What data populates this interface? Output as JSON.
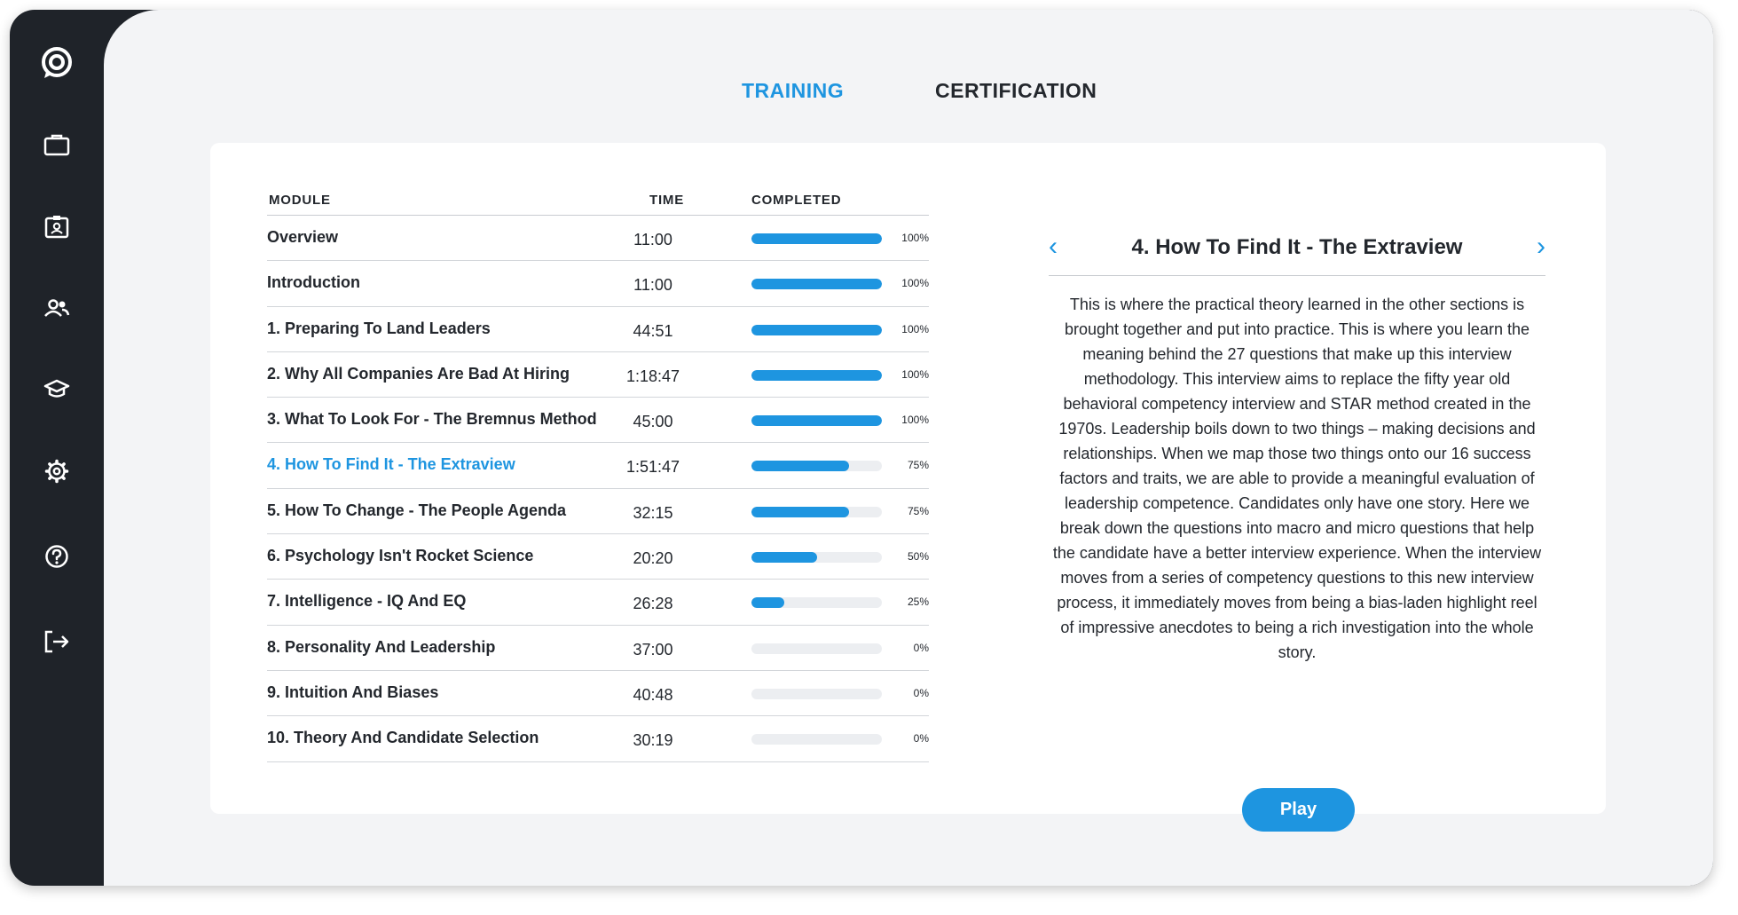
{
  "tabs": [
    {
      "label": "TRAINING"
    },
    {
      "label": "CERTIFICATION"
    }
  ],
  "table": {
    "headers": {
      "module": "MODULE",
      "time": "TIME",
      "completed": "COMPLETED"
    },
    "rows": [
      {
        "module": "Overview",
        "time": "11:00",
        "completed_pct": 100,
        "completed_label": "100%"
      },
      {
        "module": "Introduction",
        "time": "11:00",
        "completed_pct": 100,
        "completed_label": "100%"
      },
      {
        "module": "1.  Preparing To Land Leaders",
        "time": "44:51",
        "completed_pct": 100,
        "completed_label": "100%"
      },
      {
        "module": "2.  Why All Companies Are Bad At Hiring",
        "time": "1:18:47",
        "completed_pct": 100,
        "completed_label": "100%"
      },
      {
        "module": "3. What To Look For - The Bremnus Method",
        "time": "45:00",
        "completed_pct": 100,
        "completed_label": "100%"
      },
      {
        "module": "4.  How To Find It - The Extraview",
        "time": "1:51:47",
        "completed_pct": 75,
        "completed_label": "75%"
      },
      {
        "module": "5.  How To Change - The People Agenda",
        "time": "32:15",
        "completed_pct": 75,
        "completed_label": "75%"
      },
      {
        "module": "6. Psychology Isn't Rocket Science",
        "time": "20:20",
        "completed_pct": 50,
        "completed_label": "50%"
      },
      {
        "module": "7.  Intelligence - IQ And EQ",
        "time": "26:28",
        "completed_pct": 25,
        "completed_label": "25%"
      },
      {
        "module": "8. Personality And Leadership",
        "time": "37:00",
        "completed_pct": 0,
        "completed_label": "0%"
      },
      {
        "module": "9.  Intuition And Biases",
        "time": "40:48",
        "completed_pct": 0,
        "completed_label": "0%"
      },
      {
        "module": "10.  Theory And Candidate Selection",
        "time": "30:19",
        "completed_pct": 0,
        "completed_label": "0%"
      }
    ]
  },
  "detail": {
    "prev_arrow": "‹",
    "next_arrow": "›",
    "title": "4.  How To Find It - The Extraview",
    "description": "This is where the practical theory learned in the other sections is brought together and put into practice. This is where you learn the meaning behind the 27 questions that make up this interview methodology. This interview aims to replace the fifty year old behavioral competency interview and STAR method created in the 1970s. Leadership boils down to two things – making decisions and relationships. When we map those two things onto our 16 success factors and traits, we are able to provide a meaningful evaluation of leadership competence. Candidates only have one story. Here we break down the questions into macro and micro questions that help the candidate have a better interview experience. When the interview moves from a series of competency questions to this new interview process, it immediately moves from being a bias-laden highlight reel of impressive anecdotes to being a rich investigation into the whole story.",
    "play_label": "Play"
  },
  "sidebar": {
    "icons": [
      "chat-logo-icon",
      "briefcase-icon",
      "id-card-icon",
      "users-icon",
      "graduation-cap-icon",
      "gear-icon",
      "help-icon",
      "logout-icon"
    ]
  },
  "colors": {
    "accent": "#1e95e0",
    "sidebar_bg": "#1f2329",
    "main_bg": "#f3f4f6",
    "text": "#23272d",
    "track": "#eceef1"
  }
}
